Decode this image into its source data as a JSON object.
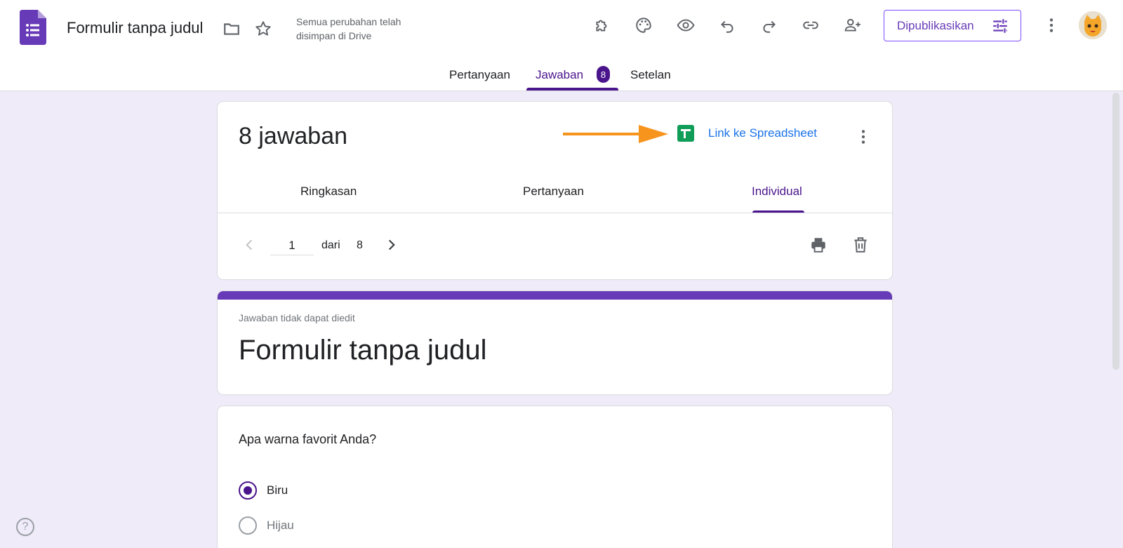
{
  "app": {
    "title": "Formulir tanpa judul",
    "save_status": "Semua perubahan telah disimpan di Drive",
    "publish_label": "Dipublikasikan",
    "brand_color": "#673ab7",
    "accent_color": "#4a148c"
  },
  "toolbar": {
    "icons": [
      "addon-icon",
      "palette-icon",
      "preview-eye-icon",
      "undo-icon",
      "redo-icon",
      "link-icon",
      "add-collaborator-icon",
      "more-vert-icon"
    ]
  },
  "main_tabs": {
    "questions": "Pertanyaan",
    "responses": "Jawaban",
    "responses_badge": "8",
    "settings": "Setelan"
  },
  "responses": {
    "count_label": "8 jawaban",
    "spreadsheet_link": "Link ke Spreadsheet",
    "sub_tabs": {
      "summary": "Ringkasan",
      "question": "Pertanyaan",
      "individual": "Individual"
    },
    "pager": {
      "current": "1",
      "of_label": "dari",
      "total": "8"
    }
  },
  "form_card": {
    "note": "Jawaban tidak dapat diedit",
    "title": "Formulir tanpa judul"
  },
  "question_card": {
    "question": "Apa warna favorit Anda?",
    "options": [
      {
        "label": "Biru",
        "selected": true
      },
      {
        "label": "Hijau",
        "selected": false
      }
    ]
  },
  "help_label": "?"
}
